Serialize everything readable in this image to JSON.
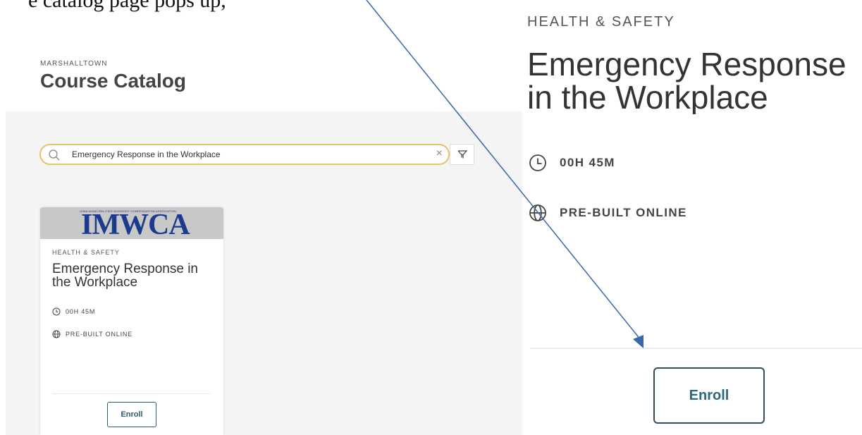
{
  "document": {
    "top_text": "e catalog page pops up, "
  },
  "catalog": {
    "org": "MARSHALLTOWN",
    "title": "Course Catalog",
    "search_value": "Emergency Response in the Workplace",
    "clear_glyph": "×"
  },
  "card": {
    "banner_small_text": "IOWA MUNICIPALITIES WORKERS' COMPENSATION ASSOCIATION",
    "banner_logo": "IMWCA",
    "category": "HEALTH & SAFETY",
    "title": "Emergency Response in the Workplace",
    "duration": "00H 45M",
    "delivery": "PRE-BUILT ONLINE",
    "enroll_label": "Enroll"
  },
  "zoom": {
    "category": "HEALTH & SAFETY",
    "title_line1": "Emergency Response",
    "title_line2": "in the Workplace",
    "duration": "00H 45M",
    "delivery": "PRE-BUILT ONLINE",
    "enroll_label": "Enroll"
  },
  "icons": {
    "search": "search-icon",
    "clear": "close-icon",
    "filter": "filter-icon",
    "duration": "clock-icon",
    "delivery": "globe-icon",
    "annotation": "arrow-icon"
  },
  "colors": {
    "search_border": "#e6c36a",
    "banner_bg": "#c8c8c8",
    "logo_blue": "#1b3b8c",
    "enroll_text": "#2b5b6e",
    "arrow": "#3b67a8",
    "catalog_bg": "#f4f4f4"
  }
}
